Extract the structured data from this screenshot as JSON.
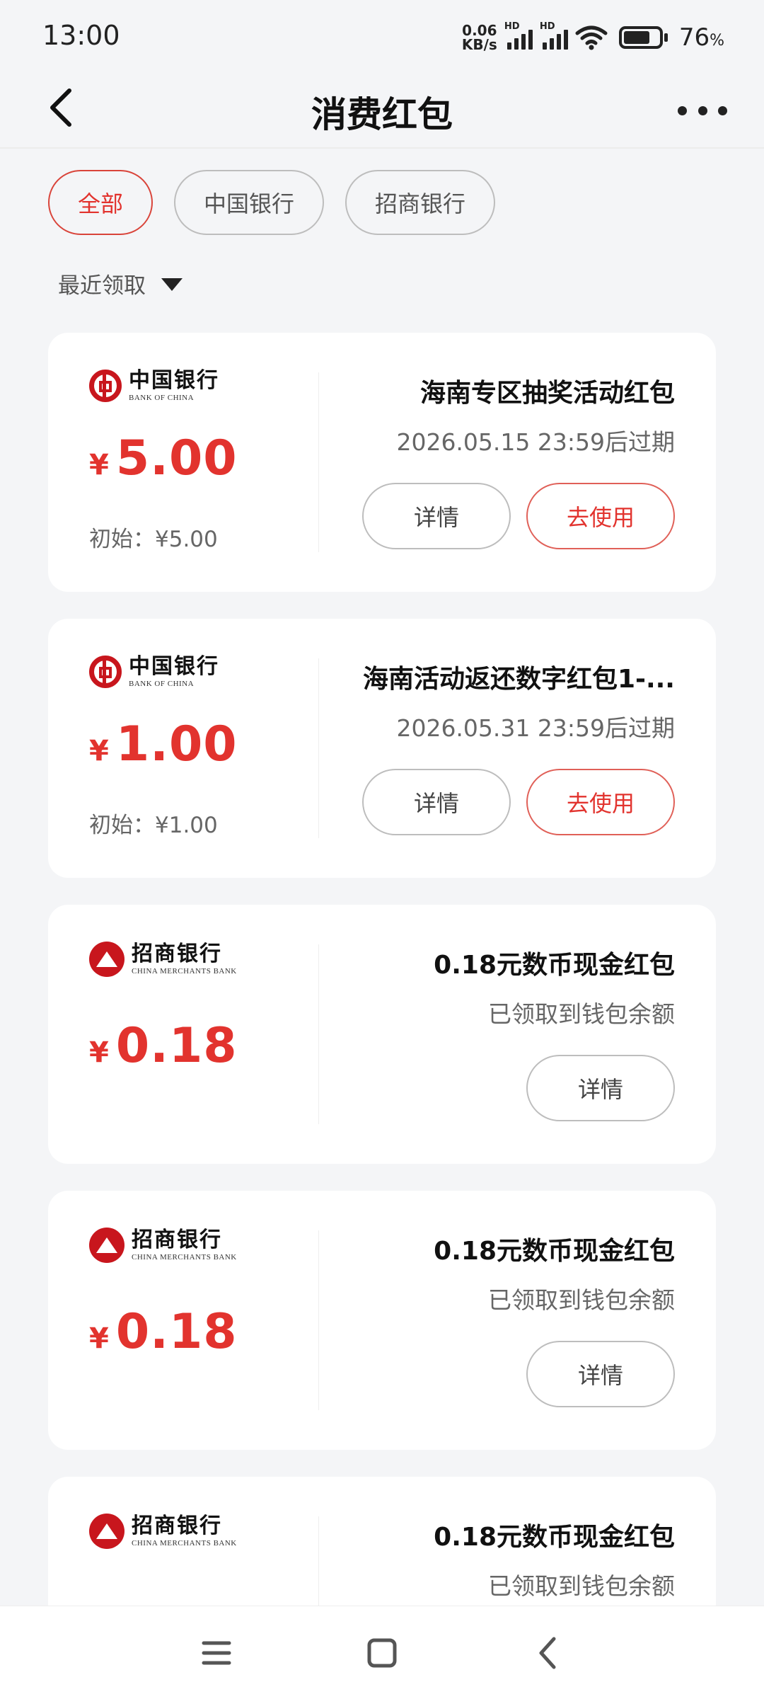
{
  "status_bar": {
    "time": "13:00",
    "net_speed_value": "0.06",
    "net_speed_unit": "KB/s",
    "sim1_label": "HD",
    "sim2_label": "HD",
    "battery_value": "76",
    "battery_unit": "%",
    "battery_level": 0.76
  },
  "header": {
    "title": "消费红包",
    "back_icon": "chevron-left-icon",
    "more_icon": "more-dots-icon"
  },
  "filters": {
    "items": [
      {
        "label": "全部",
        "active": true
      },
      {
        "label": "中国银行",
        "active": false
      },
      {
        "label": "招商银行",
        "active": false
      }
    ]
  },
  "sort": {
    "label": "最近领取"
  },
  "cards": [
    {
      "bank_cn": "中国银行",
      "bank_en": "BANK OF CHINA",
      "currency": "¥",
      "amount": "5.00",
      "initial": "初始：¥5.00",
      "title": "海南专区抽奖活动红包",
      "subtitle": "2026.05.15 23:59后过期",
      "detail_label": "详情",
      "use_label": "去使用"
    },
    {
      "bank_cn": "中国银行",
      "bank_en": "BANK OF CHINA",
      "currency": "¥",
      "amount": "1.00",
      "initial": "初始：¥1.00",
      "title": "海南活动返还数字红包1-...",
      "subtitle": "2026.05.31 23:59后过期",
      "detail_label": "详情",
      "use_label": "去使用"
    },
    {
      "bank_cn": "招商银行",
      "bank_en": "CHINA MERCHANTS BANK",
      "currency": "¥",
      "amount": "0.18",
      "title": "0.18元数币现金红包",
      "subtitle": "已领取到钱包余额",
      "detail_label": "详情"
    },
    {
      "bank_cn": "招商银行",
      "bank_en": "CHINA MERCHANTS BANK",
      "currency": "¥",
      "amount": "0.18",
      "title": "0.18元数币现金红包",
      "subtitle": "已领取到钱包余额",
      "detail_label": "详情"
    },
    {
      "bank_cn": "招商银行",
      "bank_en": "CHINA MERCHANTS BANK",
      "title": "0.18元数币现金红包",
      "subtitle": "已领取到钱包余额"
    }
  ],
  "colors": {
    "accent": "#e2332e",
    "boc_red": "#c8161d",
    "background": "#f4f5f7"
  },
  "nav_bar": {
    "icons": [
      "menu-icon",
      "home-square-icon",
      "back-arrow-icon"
    ]
  }
}
